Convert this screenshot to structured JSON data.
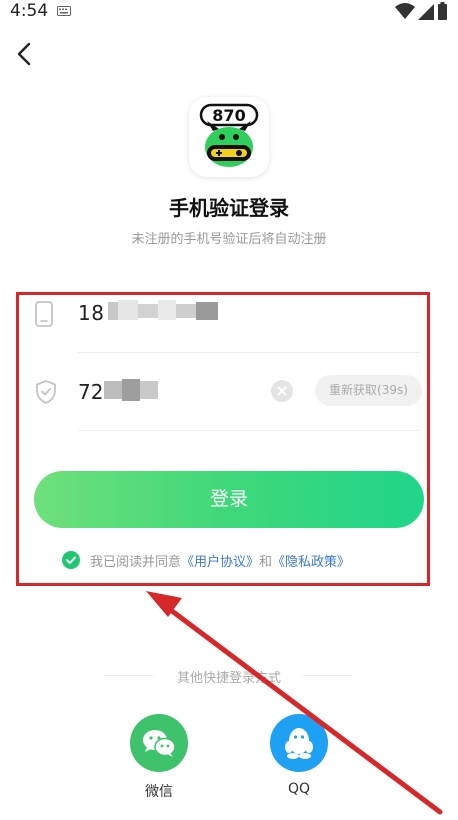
{
  "status_bar": {
    "time": "4:54"
  },
  "header": {
    "title": "手机验证登录",
    "subtitle": "未注册的手机号验证后将自动注册"
  },
  "logo": {
    "text": "870"
  },
  "form": {
    "phone_value": "18",
    "code_value": "72",
    "resend_label": "重新获取(39s)",
    "login_label": "登录"
  },
  "agreement": {
    "prefix": "我已阅读并同意",
    "user_agreement": "《用户协议》",
    "and": "和",
    "privacy_policy": "《隐私政策》"
  },
  "other_login": {
    "label": "其他快捷登录方式",
    "wechat_label": "微信",
    "qq_label": "QQ"
  },
  "colors": {
    "accent_green": "#1fc771",
    "highlight_red": "#d62828",
    "link_blue": "#3a78d8"
  }
}
